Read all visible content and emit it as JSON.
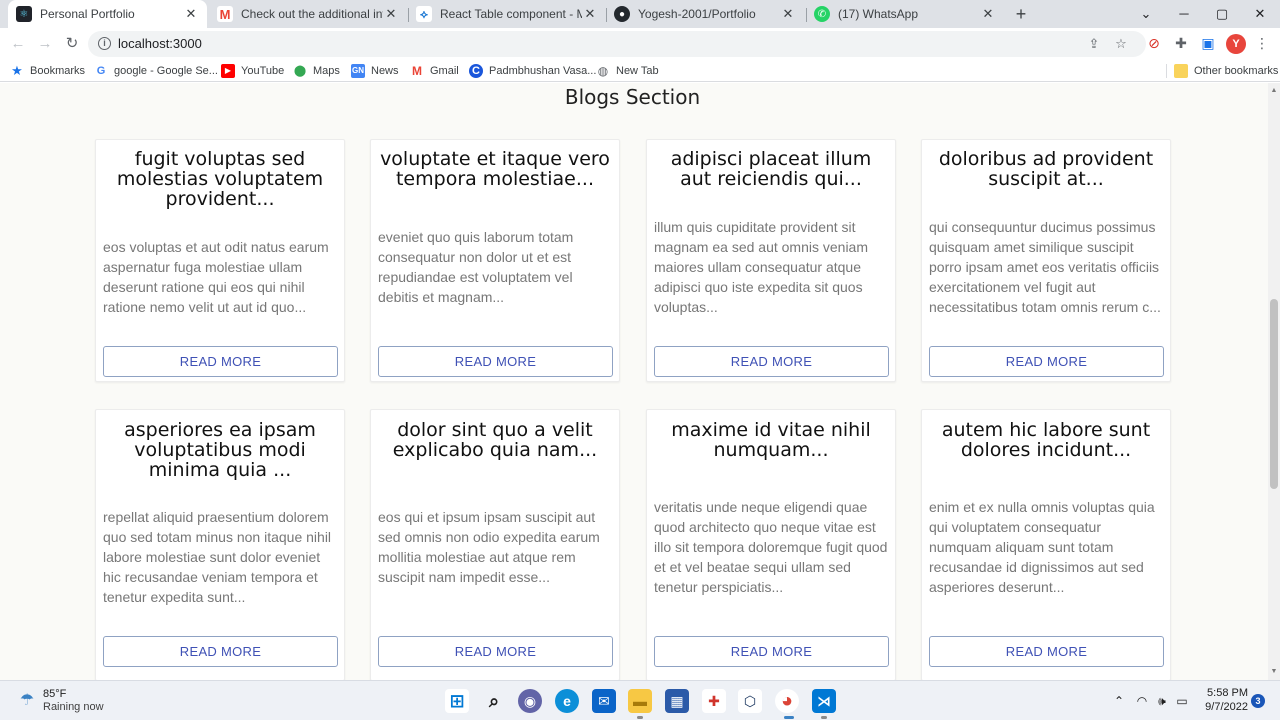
{
  "browser": {
    "tabs": [
      {
        "title": "Personal Portfolio",
        "icon": "react-icon",
        "icon_color": "#20232a"
      },
      {
        "title": "Check out the additional informa",
        "icon": "gmail-icon",
        "icon_color": "#ea4335"
      },
      {
        "title": "React Table component - Materia",
        "icon": "mui-icon",
        "icon_color": "#1976d2"
      },
      {
        "title": "Yogesh-2001/Portfolio",
        "icon": "github-icon",
        "icon_color": "#24292e"
      },
      {
        "title": "(17) WhatsApp",
        "icon": "whatsapp-icon",
        "icon_color": "#25d366"
      }
    ],
    "url": "localhost:3000",
    "profile_initial": "Y",
    "bookmarks": [
      {
        "label": "Bookmarks",
        "icon": "star-icon"
      },
      {
        "label": "google - Google Se...",
        "icon": "google-icon"
      },
      {
        "label": "YouTube",
        "icon": "youtube-icon"
      },
      {
        "label": "Maps",
        "icon": "maps-icon"
      },
      {
        "label": "News",
        "icon": "news-icon"
      },
      {
        "label": "Gmail",
        "icon": "gmail-icon"
      },
      {
        "label": "Padmbhushan Vasa...",
        "icon": "site-icon"
      },
      {
        "label": "New Tab",
        "icon": "globe-icon"
      }
    ],
    "other_bookmarks": "Other bookmarks"
  },
  "blogs": {
    "section_title": "Blogs Section",
    "read_more_label": "READ MORE",
    "accent_color": "#3f51b5",
    "cards": [
      {
        "title": "fugit voluptas sed molestias voluptatem provident...",
        "body": "eos voluptas et aut odit natus earum aspernatur fuga molestiae ullam deserunt ratione qui eos qui nihil ratione nemo velit ut aut id quo..."
      },
      {
        "title": "voluptate et itaque vero tempora molestiae...",
        "body": "eveniet quo quis laborum totam consequatur non dolor ut et est repudiandae est voluptatem vel debitis et magnam..."
      },
      {
        "title": "adipisci placeat illum aut reiciendis qui...",
        "body": "illum quis cupiditate provident sit magnam ea sed aut omnis veniam maiores ullam consequatur atque adipisci quo iste expedita sit quos voluptas..."
      },
      {
        "title": "doloribus ad provident suscipit at...",
        "body": "qui consequuntur ducimus possimus quisquam amet similique suscipit porro ipsam amet eos veritatis officiis exercitationem vel fugit aut necessitatibus totam omnis rerum c..."
      },
      {
        "title": "asperiores ea ipsam voluptatibus modi minima quia ...",
        "body": "repellat aliquid praesentium dolorem quo sed totam minus non itaque nihil labore molestiae sunt dolor eveniet hic recusandae veniam tempora et tenetur expedita sunt..."
      },
      {
        "title": "dolor sint quo a velit explicabo quia nam...",
        "body": "eos qui et ipsum ipsam suscipit aut sed omnis non odio expedita earum mollitia molestiae aut atque rem suscipit nam impedit esse..."
      },
      {
        "title": "maxime id vitae nihil numquam...",
        "body": "veritatis unde neque eligendi quae quod architecto quo neque vitae est illo sit tempora doloremque fugit quod et et vel beatae sequi ullam sed tenetur perspiciatis..."
      },
      {
        "title": "autem hic labore sunt dolores incidunt...",
        "body": "enim et ex nulla omnis voluptas quia qui voluptatem consequatur numquam aliquam sunt totam recusandae id dignissimos aut sed asperiores deserunt..."
      }
    ]
  },
  "taskbar": {
    "weather_temp": "85°F",
    "weather_desc": "Raining now",
    "time": "5:58 PM",
    "date": "9/7/2022",
    "notification_count": "3"
  }
}
